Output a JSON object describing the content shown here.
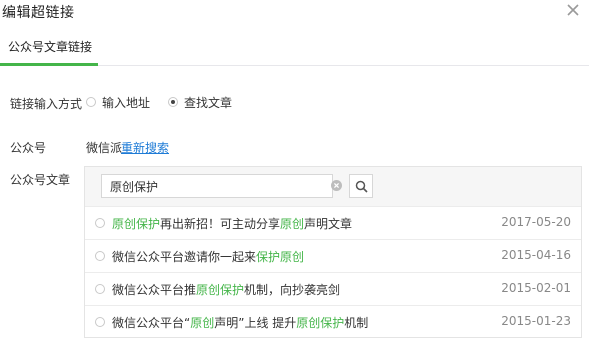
{
  "dialog": {
    "title": "编辑超链接"
  },
  "tabs": [
    {
      "label": "公众号文章链接"
    }
  ],
  "link_method": {
    "label": "链接输入方式",
    "options": [
      {
        "label": "输入地址",
        "selected": false
      },
      {
        "label": "查找文章",
        "selected": true
      }
    ]
  },
  "account": {
    "label": "公众号",
    "name": "微信派",
    "research_link": "重新搜索"
  },
  "articles": {
    "label": "公众号文章",
    "search_value": "原创保护",
    "items": [
      {
        "title_parts": [
          {
            "text": "原创保护",
            "hl": true
          },
          {
            "text": "再出新招！可主动分享",
            "hl": false
          },
          {
            "text": "原创",
            "hl": true
          },
          {
            "text": "声明文章",
            "hl": false
          }
        ],
        "date": "2017-05-20"
      },
      {
        "title_parts": [
          {
            "text": "微信公众平台邀请你一起来",
            "hl": false
          },
          {
            "text": "保护原创",
            "hl": true
          }
        ],
        "date": "2015-04-16"
      },
      {
        "title_parts": [
          {
            "text": "微信公众平台推",
            "hl": false
          },
          {
            "text": "原创保护",
            "hl": true
          },
          {
            "text": "机制，向抄袭亮剑",
            "hl": false
          }
        ],
        "date": "2015-02-01"
      },
      {
        "title_parts": [
          {
            "text": "微信公众平台“",
            "hl": false
          },
          {
            "text": "原创",
            "hl": true
          },
          {
            "text": "声明”上线 提升",
            "hl": false
          },
          {
            "text": "原创保护",
            "hl": true
          },
          {
            "text": "机制",
            "hl": false
          }
        ],
        "date": "2015-01-23"
      }
    ]
  },
  "colors": {
    "accent": "#44b549",
    "link": "#1e7bd6"
  },
  "icons": {
    "close": "close-icon",
    "clear": "clear-icon",
    "search": "search-icon"
  }
}
